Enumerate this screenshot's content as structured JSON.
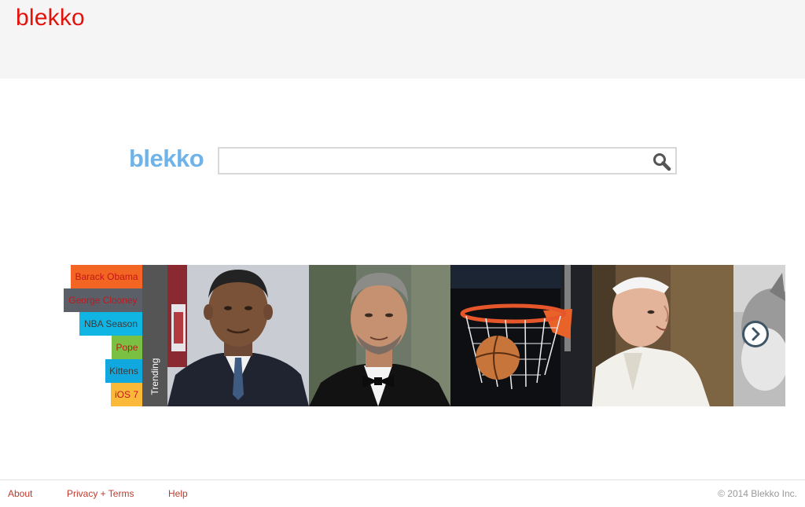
{
  "header": {
    "logo_text": "blekko"
  },
  "search": {
    "logo_text": "blekko",
    "value": "",
    "placeholder": ""
  },
  "trending": {
    "label": "Trending",
    "items": [
      {
        "label": "Barack Obama",
        "bg": "#f26522",
        "color": "#c4161c"
      },
      {
        "label": "George Clooney",
        "bg": "#5a5f68",
        "color": "#c4161c"
      },
      {
        "label": "NBA Season",
        "bg": "#11b5e4",
        "color": "#3a3a3a"
      },
      {
        "label": "Pope",
        "bg": "#7ac143",
        "color": "#c4161c"
      },
      {
        "label": "Kittens",
        "bg": "#11a8e0",
        "color": "#3a3a3a"
      },
      {
        "label": "iOS 7",
        "bg": "#fbb93a",
        "color": "#c4161c"
      }
    ],
    "tiles": [
      {
        "subject": "Barack Obama portrait"
      },
      {
        "subject": "George Clooney portrait"
      },
      {
        "subject": "Basketball going through hoop"
      },
      {
        "subject": "Pope portrait"
      },
      {
        "subject": "Kitten photo"
      }
    ]
  },
  "footer": {
    "about": "About",
    "privacy": "Privacy + Terms",
    "help": "Help",
    "copyright": "© 2014 Blekko Inc."
  },
  "colors": {
    "brand_red": "#e3120b",
    "brand_blue": "#6fb3e8",
    "footer_link": "#c0392b"
  },
  "icons": {
    "search": "magnifier-icon",
    "next": "chevron-right-icon"
  }
}
